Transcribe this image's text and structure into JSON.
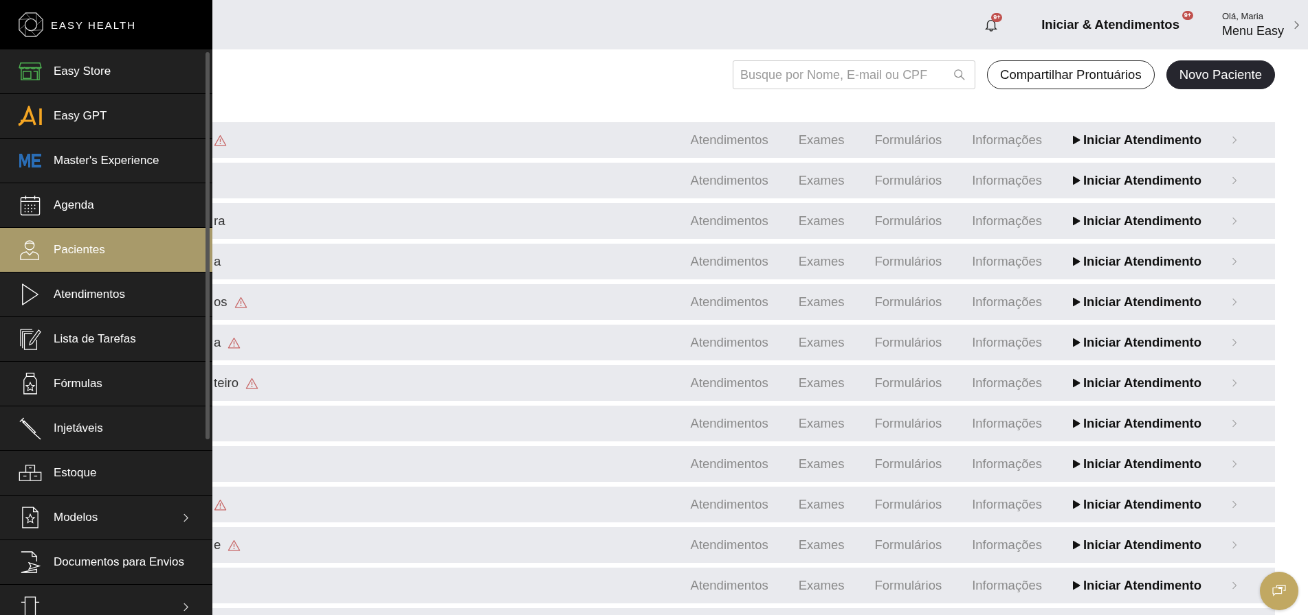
{
  "brand": "EASY HEALTH",
  "sidebar": {
    "items": [
      {
        "label": "Easy Store",
        "kind": "store",
        "selected": false,
        "has_submenu": false
      },
      {
        "label": "Easy GPT",
        "kind": "ai",
        "selected": false,
        "has_submenu": false
      },
      {
        "label": "Master's Experience",
        "kind": "me",
        "selected": false,
        "has_submenu": false
      },
      {
        "label": "Agenda",
        "kind": "calendar",
        "selected": false,
        "has_submenu": false
      },
      {
        "label": "Pacientes",
        "kind": "person",
        "selected": true,
        "has_submenu": false
      },
      {
        "label": "Atendimentos",
        "kind": "play",
        "selected": false,
        "has_submenu": false
      },
      {
        "label": "Lista de Tarefas",
        "kind": "tasks",
        "selected": false,
        "has_submenu": false
      },
      {
        "label": "Fórmulas",
        "kind": "bottle",
        "selected": false,
        "has_submenu": false
      },
      {
        "label": "Injetáveis",
        "kind": "syringe",
        "selected": false,
        "has_submenu": false
      },
      {
        "label": "Estoque",
        "kind": "boxes",
        "selected": false,
        "has_submenu": false
      },
      {
        "label": "Modelos",
        "kind": "doc-star",
        "selected": false,
        "has_submenu": true
      },
      {
        "label": "Documentos para Envios",
        "kind": "doc-send",
        "selected": false,
        "has_submenu": false
      },
      {
        "kind": "building",
        "selected": false,
        "has_submenu": true
      }
    ]
  },
  "header": {
    "notifications_badge": "9+",
    "start_link": "Iniciar & Atendimentos",
    "start_badge": "9+",
    "greeting": "Olá, Maria",
    "menu": "Menu Easy"
  },
  "toolbar": {
    "search": {
      "placeholder": "Busque por Nome, E-mail ou CPF"
    },
    "buttons": [
      {
        "label": "Compartilhar Prontuários",
        "kind": "outline"
      },
      {
        "label": "Novo Paciente",
        "kind": "primary"
      }
    ]
  },
  "patients": [
    {
      "warning": true,
      "links": [
        "Atendimentos",
        "Exames",
        "Formulários",
        "Informações"
      ],
      "action": "Iniciar Atendimento"
    },
    {
      "warning": false,
      "links": [
        "Atendimentos",
        "Exames",
        "Formulários",
        "Informações"
      ],
      "action": "Iniciar Atendimento"
    },
    {
      "name": "ra",
      "warning": false,
      "links": [
        "Atendimentos",
        "Exames",
        "Formulários",
        "Informações"
      ],
      "action": "Iniciar Atendimento"
    },
    {
      "name": "a",
      "warning": false,
      "links": [
        "Atendimentos",
        "Exames",
        "Formulários",
        "Informações"
      ],
      "action": "Iniciar Atendimento"
    },
    {
      "name": "os",
      "warning": true,
      "links": [
        "Atendimentos",
        "Exames",
        "Formulários",
        "Informações"
      ],
      "action": "Iniciar Atendimento"
    },
    {
      "name": "a",
      "warning": true,
      "links": [
        "Atendimentos",
        "Exames",
        "Formulários",
        "Informações"
      ],
      "action": "Iniciar Atendimento"
    },
    {
      "name": "teiro",
      "warning": true,
      "links": [
        "Atendimentos",
        "Exames",
        "Formulários",
        "Informações"
      ],
      "action": "Iniciar Atendimento"
    },
    {
      "warning": false,
      "links": [
        "Atendimentos",
        "Exames",
        "Formulários",
        "Informações"
      ],
      "action": "Iniciar Atendimento"
    },
    {
      "warning": false,
      "links": [
        "Atendimentos",
        "Exames",
        "Formulários",
        "Informações"
      ],
      "action": "Iniciar Atendimento"
    },
    {
      "warning": true,
      "links": [
        "Atendimentos",
        "Exames",
        "Formulários",
        "Informações"
      ],
      "action": "Iniciar Atendimento"
    },
    {
      "name": "e",
      "warning": true,
      "links": [
        "Atendimentos",
        "Exames",
        "Formulários",
        "Informações"
      ],
      "action": "Iniciar Atendimento"
    },
    {
      "warning": false,
      "links": [
        "Atendimentos",
        "Exames",
        "Formulários",
        "Informações"
      ],
      "action": "Iniciar Atendimento"
    }
  ]
}
